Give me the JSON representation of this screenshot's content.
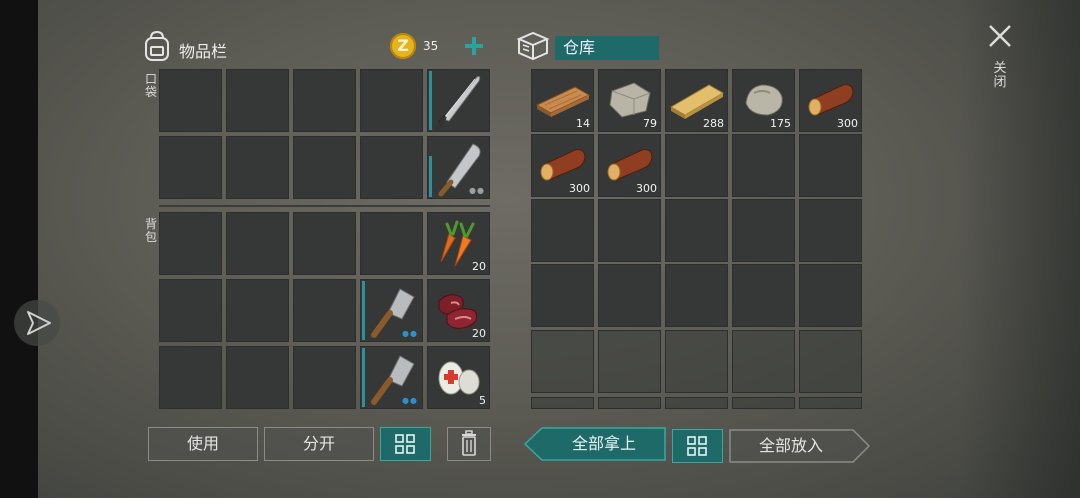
{
  "inventory": {
    "title": "物品栏",
    "coins": "35",
    "coin_symbol": "Z",
    "pocket_label": "口袋",
    "backpack_label": "背包",
    "slots": {
      "pocket_weapon1": {
        "icon": "machete-icon"
      },
      "pocket_weapon2": {
        "icon": "cleaver-blade-icon",
        "dots": "●●"
      },
      "carrot": {
        "icon": "carrot-icon",
        "count": "20"
      },
      "meat": {
        "icon": "raw-meat-icon",
        "count": "20"
      },
      "cleaver1": {
        "icon": "cleaver-icon",
        "dots": "●●"
      },
      "cleaver2": {
        "icon": "cleaver-icon",
        "dots": "●●"
      },
      "bandage": {
        "icon": "bandage-icon",
        "count": "5"
      }
    }
  },
  "storage": {
    "title": "仓库",
    "items": [
      {
        "icon": "plank-icon",
        "count": "14"
      },
      {
        "icon": "stone-icon",
        "count": "79"
      },
      {
        "icon": "plank-icon",
        "count": "288"
      },
      {
        "icon": "rock-icon",
        "count": "175"
      },
      {
        "icon": "log-icon",
        "count": "300"
      },
      {
        "icon": "log-icon",
        "count": "300"
      },
      {
        "icon": "log-icon",
        "count": "300"
      }
    ]
  },
  "buttons": {
    "use": "使用",
    "split": "分开",
    "take_all": "全部拿上",
    "put_all": "全部放入"
  },
  "close": {
    "symbol": "✕",
    "label": "关闭"
  },
  "colors": {
    "accent": "#1e6a69",
    "accent_border": "#3aa7a1",
    "slot": "#353836",
    "durability": "#2f8f9a"
  }
}
